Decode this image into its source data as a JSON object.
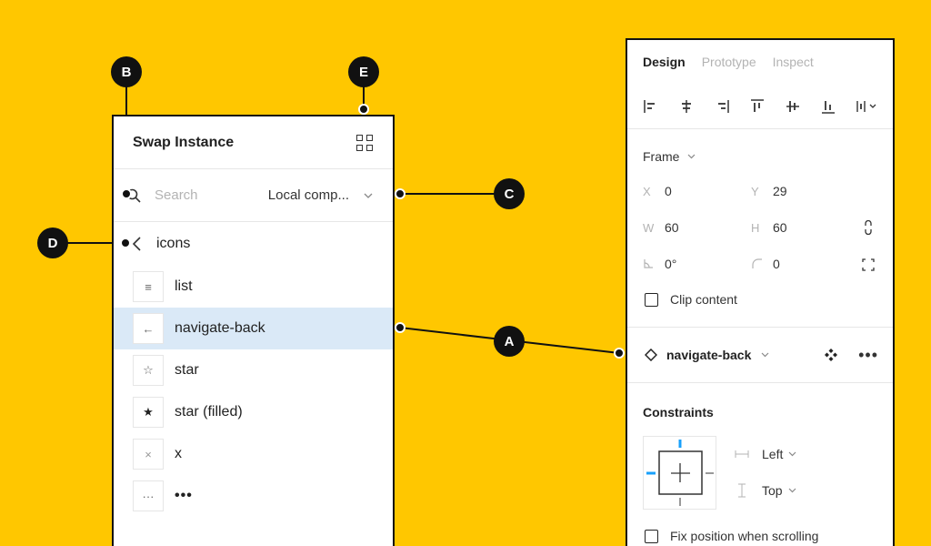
{
  "colors": {
    "background": "#FFC700",
    "selected_row": "#DAE9F7",
    "constraint_accent": "#18A0FB",
    "callout": "#111111"
  },
  "swap_panel": {
    "title": "Swap Instance",
    "search_placeholder": "Search",
    "scope_label": "Local comp...",
    "back_label": "icons",
    "items": [
      {
        "label": "list",
        "glyph": "≡",
        "icon": "list-icon"
      },
      {
        "label": "navigate-back",
        "glyph": "←",
        "icon": "arrow-left-icon",
        "selected": true
      },
      {
        "label": "star",
        "glyph": "☆",
        "icon": "star-outline-icon"
      },
      {
        "label": "star (filled)",
        "glyph": "★",
        "icon": "star-filled-icon"
      },
      {
        "label": "x",
        "glyph": "×",
        "icon": "x-icon"
      },
      {
        "label": "•••",
        "glyph": "···",
        "icon": "more-icon"
      }
    ]
  },
  "callouts": {
    "a": "A",
    "b": "B",
    "c": "C",
    "d": "D",
    "e": "E"
  },
  "design_panel": {
    "tabs": [
      {
        "label": "Design",
        "active": true
      },
      {
        "label": "Prototype",
        "active": false
      },
      {
        "label": "Inspect",
        "active": false
      }
    ],
    "frame_label": "Frame",
    "fields": {
      "x_label": "X",
      "x_value": "0",
      "y_label": "Y",
      "y_value": "29",
      "w_label": "W",
      "w_value": "60",
      "h_label": "H",
      "h_value": "60",
      "rotation_value": "0°",
      "radius_value": "0"
    },
    "clip_content_label": "Clip content",
    "instance_name": "navigate-back",
    "constraints_title": "Constraints",
    "horizontal_constraint": "Left",
    "vertical_constraint": "Top",
    "fix_position_label": "Fix position when scrolling"
  }
}
